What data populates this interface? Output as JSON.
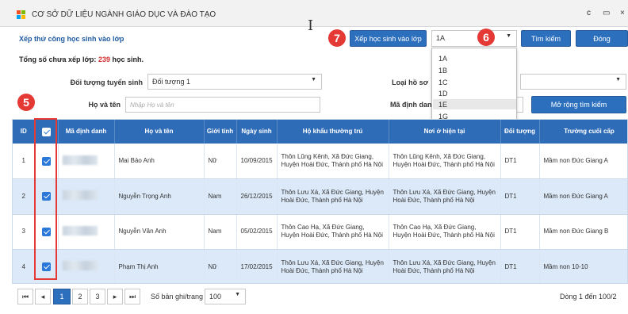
{
  "window": {
    "title": "CƠ SỞ DỮ LIỆU NGÀNH GIÁO DỤC VÀ ĐÀO TẠO",
    "controls": [
      "c",
      "▭",
      "×"
    ],
    "logo_colors": [
      "#f25022",
      "#7fba00",
      "#00a4ef",
      "#ffb900"
    ]
  },
  "breadcrumb": "Xếp thứ công học sinh vào lớp",
  "toolbar": {
    "assign_button": "Xếp học sinh vào lớp",
    "class_select_value": "1A",
    "search_button": "Tìm kiếm",
    "close_button": "Đóng",
    "class_options": [
      "1A",
      "1B",
      "1C",
      "1D",
      "1E",
      "1G"
    ],
    "highlighted_option": "1E"
  },
  "annotations": {
    "step5": "5",
    "step6": "6",
    "step7": "7"
  },
  "summary": {
    "prefix": "Tổng số chưa xếp lớp:",
    "count": "239",
    "suffix": "học sinh."
  },
  "filters": {
    "target_label": "Đối tượng tuyển sinh",
    "target_value": "Đối tượng 1",
    "record_type_label": "Loại hồ sơ",
    "name_label": "Họ và tên",
    "name_placeholder": "Nhập Họ và tên",
    "id_label": "Mã định danh",
    "expand_button": "Mở rộng tìm kiếm"
  },
  "table": {
    "headers": [
      "ID",
      "",
      "Mã định danh",
      "Họ và tên",
      "Giới tính",
      "Ngày sinh",
      "Hộ khẩu thường trú",
      "Nơi ở hiện tại",
      "Đối tượng",
      "Trường cuối cấp"
    ],
    "rows": [
      {
        "id": "1",
        "name": "Mai Bảo Anh",
        "gender": "Nữ",
        "dob": "10/09/2015",
        "permanent": "Thôn Lũng Kênh, Xã Đức Giang, Huyện Hoài Đức, Thành phố Hà Nội",
        "current": "Thôn Lũng Kênh, Xã Đức Giang, Huyện Hoài Đức, Thành phố Hà Nội",
        "target": "DT1",
        "school": "Mầm non Đức Giang A"
      },
      {
        "id": "2",
        "name": "Nguyễn Trọng Anh",
        "gender": "Nam",
        "dob": "26/12/2015",
        "permanent": "Thôn Lưu Xá, Xã Đức Giang, Huyện Hoài Đức, Thành phố Hà Nội",
        "current": "Thôn Lưu Xá, Xã Đức Giang, Huyện Hoài Đức, Thành phố Hà Nội",
        "target": "DT1",
        "school": "Mầm non Đức Giang A"
      },
      {
        "id": "3",
        "name": "Nguyễn Văn Anh",
        "gender": "Nam",
        "dob": "05/02/2015",
        "permanent": "Thôn Cao Hạ, Xã Đức Giang, Huyện Hoài Đức, Thành phố Hà Nội",
        "current": "Thôn Cao Hạ, Xã Đức Giang, Huyện Hoài Đức, Thành phố Hà Nội",
        "target": "DT1",
        "school": "Mầm non Đức Giang B"
      },
      {
        "id": "4",
        "name": "Phạm Thị Anh",
        "gender": "Nữ",
        "dob": "17/02/2015",
        "permanent": "Thôn Lưu Xá, Xã Đức Giang, Huyện Hoài Đức, Thành phố Hà Nội",
        "current": "Thôn Lưu Xá, Xã Đức Giang, Huyện Hoài Đức, Thành phố Hà Nội",
        "target": "DT1",
        "school": "Mầm non 10-10"
      }
    ]
  },
  "pagination": {
    "first": "⏮",
    "prev": "◂",
    "pages": [
      "1",
      "2",
      "3"
    ],
    "next": "▸",
    "last": "⏭",
    "per_page_label": "Số bản ghi/trang",
    "per_page_value": "100",
    "info": "Dòng 1 đến 100/2"
  },
  "colors": {
    "accent": "#2c6fbd",
    "header": "#2f6cb7",
    "alt_row": "#dbe9f8",
    "annotation": "#e53935"
  }
}
